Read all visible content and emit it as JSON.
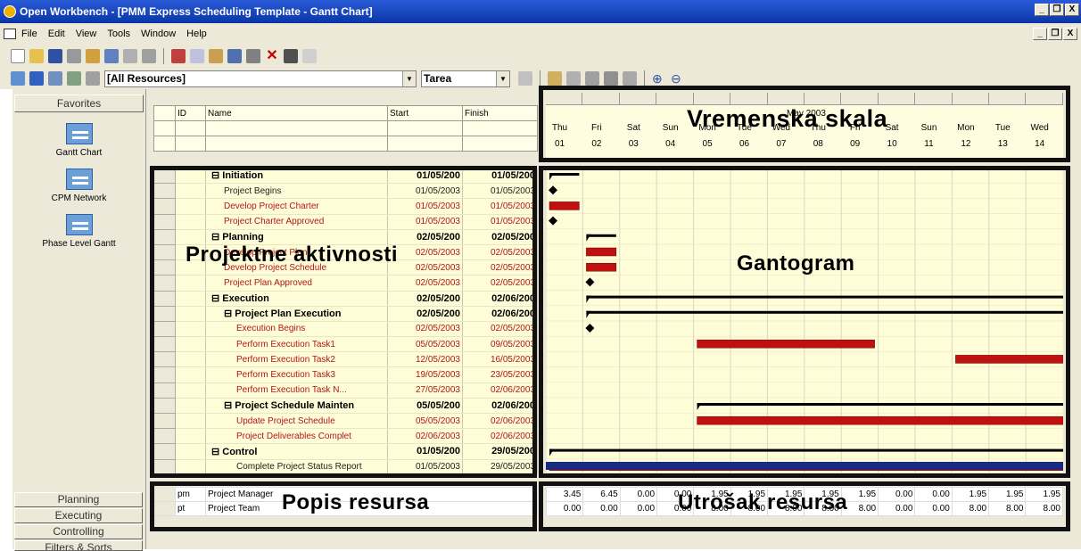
{
  "window": {
    "title": "Open Workbench - [PMM Express Scheduling Template - Gantt Chart]",
    "controls": [
      "_",
      "❐",
      "X"
    ]
  },
  "menu": {
    "items": [
      "File",
      "Edit",
      "View",
      "Tools",
      "Window",
      "Help"
    ]
  },
  "toolbar": {
    "resource_filter": "[All Resources]",
    "type_combo": "Tarea"
  },
  "sidebar": {
    "favorites": "Favorites",
    "views": [
      "Gantt Chart",
      "CPM Network",
      "Phase Level Gantt"
    ],
    "bottom_buttons": [
      "Planning",
      "Executing",
      "Controlling",
      "Filters & Sorts"
    ]
  },
  "grid": {
    "columns": [
      "ID",
      "Name",
      "Start",
      "Finish"
    ],
    "tasks": [
      {
        "name": "⊟ Initiation",
        "start": "01/05/200",
        "finish": "01/05/200",
        "bold": true,
        "color": "#000000",
        "indent": 0
      },
      {
        "name": "Project Begins",
        "start": "01/05/2003",
        "finish": "01/05/2003",
        "bold": false,
        "color": "#222222",
        "indent": 1
      },
      {
        "name": "Develop Project Charter",
        "start": "01/05/2003",
        "finish": "01/05/2003",
        "bold": false,
        "color": "#b01818",
        "indent": 1
      },
      {
        "name": "Project Charter Approved",
        "start": "01/05/2003",
        "finish": "01/05/2003",
        "bold": false,
        "color": "#b01818",
        "indent": 1
      },
      {
        "name": "⊟ Planning",
        "start": "02/05/200",
        "finish": "02/05/200",
        "bold": true,
        "color": "#000000",
        "indent": 0
      },
      {
        "name": "Develop Project Plan",
        "start": "02/05/2003",
        "finish": "02/05/2003",
        "bold": false,
        "color": "#b01818",
        "indent": 1
      },
      {
        "name": "Develop Project Schedule",
        "start": "02/05/2003",
        "finish": "02/05/2003",
        "bold": false,
        "color": "#b01818",
        "indent": 1
      },
      {
        "name": "Project Plan Approved",
        "start": "02/05/2003",
        "finish": "02/05/2003",
        "bold": false,
        "color": "#b01818",
        "indent": 1
      },
      {
        "name": "⊟ Execution",
        "start": "02/05/200",
        "finish": "02/06/200",
        "bold": true,
        "color": "#000000",
        "indent": 0
      },
      {
        "name": "⊟ Project Plan Execution",
        "start": "02/05/200",
        "finish": "02/06/200",
        "bold": true,
        "color": "#000000",
        "indent": 1
      },
      {
        "name": "Execution Begins",
        "start": "02/05/2003",
        "finish": "02/05/2003",
        "bold": false,
        "color": "#b01818",
        "indent": 2
      },
      {
        "name": "Perform Execution Task1",
        "start": "05/05/2003",
        "finish": "09/05/2003",
        "bold": false,
        "color": "#b01818",
        "indent": 2
      },
      {
        "name": "Perform Execution Task2",
        "start": "12/05/2003",
        "finish": "16/05/2003",
        "bold": false,
        "color": "#b01818",
        "indent": 2
      },
      {
        "name": "Perform Execution Task3",
        "start": "19/05/2003",
        "finish": "23/05/2003",
        "bold": false,
        "color": "#b01818",
        "indent": 2
      },
      {
        "name": "Perform Execution Task N...",
        "start": "27/05/2003",
        "finish": "02/06/2003",
        "bold": false,
        "color": "#b01818",
        "indent": 2
      },
      {
        "name": "⊟ Project Schedule Mainten",
        "start": "05/05/200",
        "finish": "02/06/200",
        "bold": true,
        "color": "#000000",
        "indent": 1
      },
      {
        "name": "Update Project Schedule",
        "start": "05/05/2003",
        "finish": "02/06/2003",
        "bold": false,
        "color": "#b01818",
        "indent": 2
      },
      {
        "name": "Project Deliverables Complet",
        "start": "02/06/2003",
        "finish": "02/06/2003",
        "bold": false,
        "color": "#b01818",
        "indent": 2
      },
      {
        "name": "⊟ Control",
        "start": "01/05/200",
        "finish": "29/05/200",
        "bold": true,
        "color": "#000000",
        "indent": 0
      },
      {
        "name": "Complete Project Status Report",
        "start": "01/05/2003",
        "finish": "29/05/2003",
        "bold": false,
        "color": "#222222",
        "indent": 2
      }
    ]
  },
  "timescale": {
    "month": "May 2003",
    "days": [
      {
        "d": "Thu",
        "n": "01"
      },
      {
        "d": "Fri",
        "n": "02"
      },
      {
        "d": "Sat",
        "n": "03"
      },
      {
        "d": "Sun",
        "n": "04"
      },
      {
        "d": "Mon",
        "n": "05"
      },
      {
        "d": "Tue",
        "n": "06"
      },
      {
        "d": "Wed",
        "n": "07"
      },
      {
        "d": "Thu",
        "n": "08"
      },
      {
        "d": "Fri",
        "n": "09"
      },
      {
        "d": "Sat",
        "n": "10"
      },
      {
        "d": "Sun",
        "n": "11"
      },
      {
        "d": "Mon",
        "n": "12"
      },
      {
        "d": "Tue",
        "n": "13"
      },
      {
        "d": "Wed",
        "n": "14"
      }
    ]
  },
  "resources": {
    "rows": [
      {
        "id": "pm",
        "name": "Project Manager",
        "usage": [
          "3.45",
          "6.45",
          "0.00",
          "0.00",
          "1.95",
          "1.95",
          "1.95",
          "1.95",
          "1.95",
          "0.00",
          "0.00",
          "1.95",
          "1.95",
          "1.95"
        ]
      },
      {
        "id": "pt",
        "name": "Project Team",
        "usage": [
          "0.00",
          "0.00",
          "0.00",
          "0.00",
          "8.00",
          "8.00",
          "8.00",
          "8.00",
          "8.00",
          "0.00",
          "0.00",
          "8.00",
          "8.00",
          "8.00"
        ]
      }
    ]
  },
  "annotations": {
    "timescale": "Vremenska skala",
    "activities": "Projektne aktivnosti",
    "gantt": "Gantogram",
    "resources": "Popis resursa",
    "usage": "Utrošak resursa"
  }
}
